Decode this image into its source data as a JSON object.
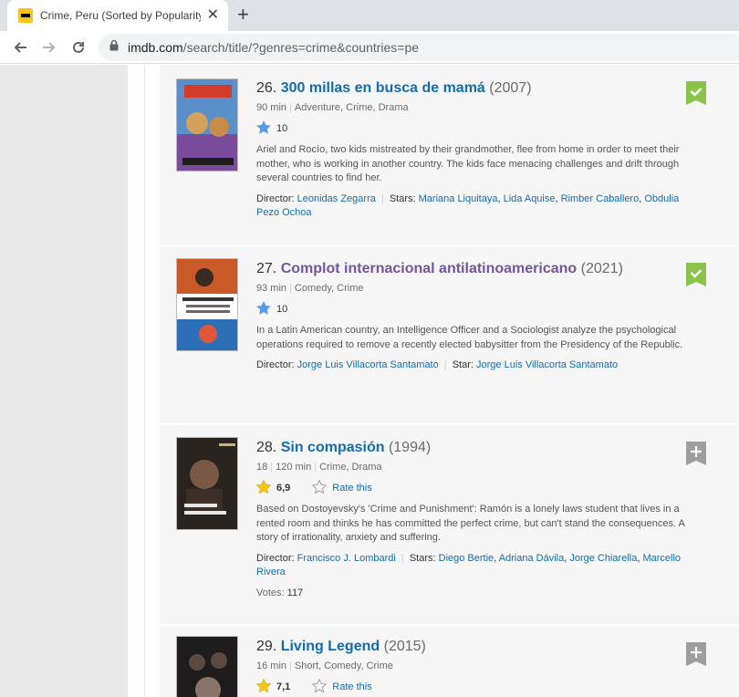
{
  "browser": {
    "tab_title": "Crime, Peru (Sorted by Popularity",
    "url_host": "imdb.com",
    "url_path": "/search/title/?genres=crime&countries=pe"
  },
  "results": [
    {
      "index": "26.",
      "title": "300 millas en busca de mamá",
      "year": "(2007)",
      "runtime": "90 min",
      "genres": "Adventure, Crime, Drama",
      "rating": "10",
      "rating_style": "user",
      "description": "Ariel and Rocío, two kids mistreated by their grandmother, flee from home in order to meet their mother, who is working in another country. The kids face menacing challenges and drift through several countries to find her.",
      "director_label": "Director:",
      "directors": [
        "Leonidas Zegarra"
      ],
      "stars_label": "Stars:",
      "stars": [
        "Mariana Liquitaya",
        "Lida Aquise",
        "Rimber Caballero",
        "Obdulia Pezo Ochoa"
      ],
      "watchlist": "added"
    },
    {
      "index": "27.",
      "title": "Complot internacional antilatinoamericano",
      "year": "(2021)",
      "runtime": "93 min",
      "genres": "Comedy, Crime",
      "rating": "10",
      "rating_style": "user",
      "description": "In a Latin American country, an Intelligence Officer and a Sociologist analyze the psychological operations required to remove a recently elected babysitter from the Presidency of the Republic.",
      "director_label": "Director:",
      "directors": [
        "Jorge Luis Villacorta Santamato"
      ],
      "stars_label": "Star:",
      "stars": [
        "Jorge Luis Villacorta Santamato"
      ],
      "watchlist": "added"
    },
    {
      "index": "28.",
      "title": "Sin compasión",
      "year": "(1994)",
      "certificate": "18",
      "runtime": "120 min",
      "genres": "Crime, Drama",
      "rating": "6,9",
      "rating_style": "imdb",
      "rate_label": "Rate this",
      "description": "Based on Dostoyevsky's 'Crime and Punishment': Ramón is a lonely laws student that lives in a rented room and thinks he has committed the perfect crime, but can't stand the consequences. A story of irrationality, anxiety and suffering.",
      "director_label": "Director:",
      "directors": [
        "Francisco J. Lombardi"
      ],
      "stars_label": "Stars:",
      "stars": [
        "Diego Bertie",
        "Adriana Dávila",
        "Jorge Chiarella",
        "Marcello Rivera"
      ],
      "votes_label": "Votes:",
      "votes": "117",
      "watchlist": "add"
    },
    {
      "index": "29.",
      "title": "Living Legend",
      "year": "(2015)",
      "runtime": "16 min",
      "genres": "Short, Comedy, Crime",
      "rating": "7,1",
      "rating_style": "imdb",
      "rate_label": "Rate this",
      "watchlist": "add"
    }
  ],
  "colors": {
    "link": "#136cb2",
    "visited": "#70579d",
    "watchlist_added": "#8bc34a",
    "watchlist_add": "#9e9e9e",
    "imdb_star": "#f5c518",
    "user_star": "#5799ef"
  }
}
